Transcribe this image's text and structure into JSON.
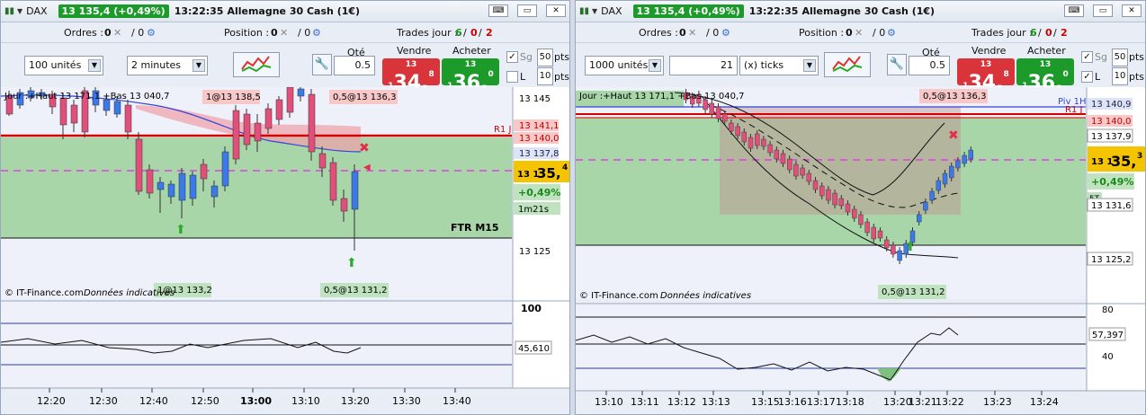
{
  "left": {
    "instrument": "DAX",
    "price_badge": "13 135,4 (+0,49%)",
    "time": "13:22:35",
    "name": "Allemagne 30 Cash (1€)",
    "orders_label": "Ordres :",
    "orders_a": "0",
    "orders_b": "/ 0",
    "position_label": "Position :",
    "position_a": "0",
    "position_b": "/ 0",
    "trades_label": "Trades jour :",
    "trades_a": "6",
    "trades_b": "0",
    "trades_c": "2",
    "units": "100 unités",
    "period": "2 minutes",
    "qty_label": "Qté",
    "qty_value": "0.5",
    "sell_label": "Vendre",
    "buy_label": "Acheter",
    "sell_small": "13 1",
    "sell_big": "34,",
    "sell_exp": "8",
    "buy_small": "13 1",
    "buy_big": "36,",
    "buy_exp": "0",
    "sg_label": "Sg",
    "l_label": "L",
    "pts1": "50",
    "pts2": "10",
    "pts_label": "pts",
    "chart_header": "Jour :+Haut 13 171,1 +Bas 13 040,7",
    "order_tag1": "1@13 138,5",
    "order_tag2": "0,5@13 136,3",
    "order_tag3": "1@13 133,2",
    "order_tag4": "0,5@13 131,2",
    "r1_label": "R1 J",
    "zone_label": "FTR M15",
    "yticks": [
      "13 145",
      "13 125"
    ],
    "ylabels": [
      "13 141,1",
      "13 140,0",
      "13 137,8"
    ],
    "last_price_small": "13 1",
    "last_price_big": "35,",
    "last_price_exp": "4",
    "change": "+0,49%",
    "countdown": "1m21s",
    "copyright": "© IT-Finance.com",
    "disclaimer": "Données indicatives",
    "osc_top": "100",
    "osc_value": "45,610",
    "xticks": [
      "12:20",
      "12:30",
      "12:40",
      "12:50",
      "13:00",
      "13:10",
      "13:20",
      "13:30",
      "13:40"
    ]
  },
  "right": {
    "instrument": "DAX",
    "price_badge": "13 135,4 (+0,49%)",
    "time": "13:22:35",
    "name": "Allemagne 30 Cash (1€)",
    "orders_label": "Ordres :",
    "orders_a": "0",
    "orders_b": "/ 0",
    "position_label": "Position :",
    "position_a": "0",
    "position_b": "/ 0",
    "trades_label": "Trades jour :",
    "trades_a": "6",
    "trades_b": "0",
    "trades_c": "2",
    "units": "1000 unités",
    "ticks_value": "21",
    "ticks_unit": "(x) ticks",
    "qty_label": "Qté",
    "qty_value": "0.5",
    "sell_label": "Vendre",
    "buy_label": "Acheter",
    "sell_small": "13 1",
    "sell_big": "34,",
    "sell_exp": "8",
    "buy_small": "13 1",
    "buy_big": "36,",
    "buy_exp": "0",
    "sg_label": "Sg",
    "l_label": "L",
    "pts1": "50",
    "pts2": "10",
    "pts_label": "pts",
    "chart_header": "Jour :+Haut 13 171,1 +Bas 13 040,7",
    "order_tag2": "0,5@13 136,3",
    "order_tag4": "0,5@13 131,2",
    "piv_label": "Piv 1H",
    "r1_label": "R1 J",
    "ylabels": [
      "13 140,9",
      "13 140,0",
      "13 137,9",
      "13 131,6",
      "13 125,2"
    ],
    "last_price_small": "13 1",
    "last_price_big": "35,",
    "last_price_exp": "3",
    "change": "+0,49%",
    "st_label": "5T",
    "copyright": "© IT-Finance.com",
    "disclaimer": "Données indicatives",
    "osc_80": "80",
    "osc_40": "40",
    "osc_value": "57,397",
    "xticks": [
      "13:10",
      "13:11",
      "13:12",
      "13:13",
      "13:15",
      "13:16",
      "13:17",
      "13:18",
      "13:20",
      "13:21",
      "13:22",
      "13:23",
      "13:24"
    ]
  },
  "colors": {
    "bull": "#3b78e8",
    "bear": "#e0507a",
    "zone_green": "#a8d6a8",
    "pink_line": "#e040e0",
    "r1_red": "#d40000",
    "highlight_yellow": "#f5c400"
  }
}
